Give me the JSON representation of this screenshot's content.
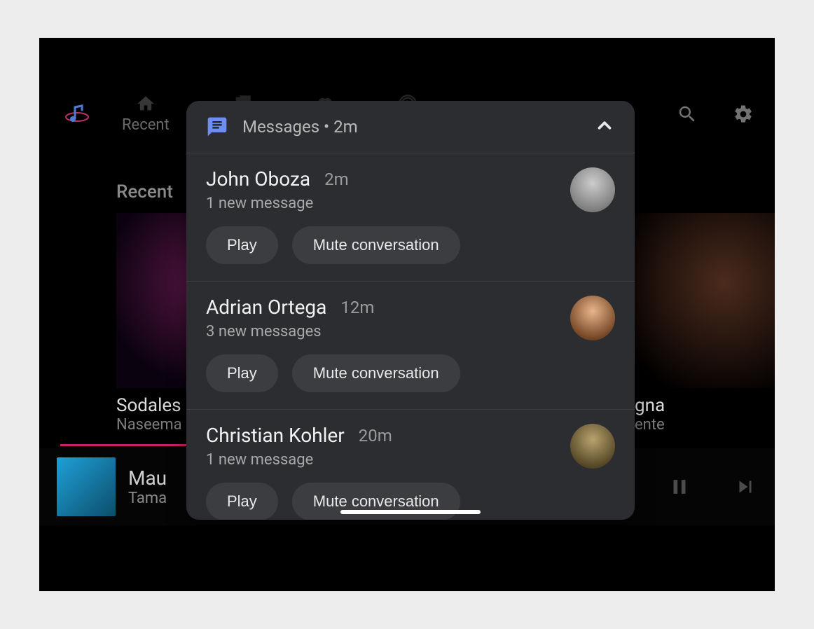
{
  "nav": {
    "tabs": [
      {
        "icon": "home",
        "label": "Recent"
      }
    ],
    "hidden_icons": [
      "library",
      "heart",
      "podcast"
    ]
  },
  "section_title": "Recent",
  "cards": [
    {
      "title": "Sodales",
      "subtitle": "Naseema"
    },
    {
      "title": "gna",
      "subtitle": "ente"
    }
  ],
  "now_playing": {
    "title": "Mau",
    "subtitle": "Tama"
  },
  "panel": {
    "header": "Messages • 2m",
    "items": [
      {
        "name": "John Oboza",
        "time": "2m",
        "sub": "1 new message",
        "play": "Play",
        "mute": "Mute conversation"
      },
      {
        "name": "Adrian Ortega",
        "time": "12m",
        "sub": "3 new messages",
        "play": "Play",
        "mute": "Mute conversation"
      },
      {
        "name": "Christian Kohler",
        "time": "20m",
        "sub": "1 new message",
        "play": "Play",
        "mute": "Mute conversation"
      }
    ]
  }
}
